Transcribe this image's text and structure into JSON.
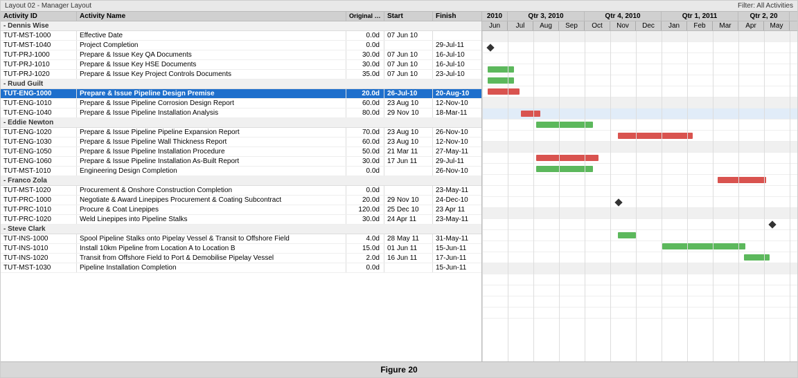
{
  "topBar": {
    "layout": "Layout 02 - Manager Layout",
    "filter": "Filter: All Activities"
  },
  "tableHeaders": {
    "activityId": "Activity ID",
    "activityName": "Activity Name",
    "originalDuration": "Original Duration",
    "start": "Start",
    "finish": "Finish"
  },
  "groups": [
    {
      "name": "Dennis Wise",
      "rows": [
        {
          "id": "TUT-MST-1000",
          "name": "Effective Date",
          "orig": "0.0d",
          "start": "07 Jun 10",
          "finish": "",
          "barType": "milestone",
          "barPos": 0
        },
        {
          "id": "TUT-MST-1040",
          "name": "Project Completion",
          "orig": "0.0d",
          "start": "",
          "finish": "29-Jul-11",
          "barType": "none",
          "barPos": 0
        },
        {
          "id": "TUT-PRJ-1000",
          "name": "Prepare & Issue Key QA Documents",
          "orig": "30.0d",
          "start": "07 Jun 10",
          "finish": "16-Jul-10",
          "barType": "green",
          "barPos": 1
        },
        {
          "id": "TUT-PRJ-1010",
          "name": "Prepare & Issue Key HSE Documents",
          "orig": "30.0d",
          "start": "07 Jun 10",
          "finish": "16-Jul-10",
          "barType": "green",
          "barPos": 1
        },
        {
          "id": "TUT-PRJ-1020",
          "name": "Prepare & Issue Key Project Controls Documents",
          "orig": "35.0d",
          "start": "07 Jun 10",
          "finish": "23-Jul-10",
          "barType": "red",
          "barPos": 1
        }
      ]
    },
    {
      "name": "Ruud Guilt",
      "rows": [
        {
          "id": "TUT-ENG-1000",
          "name": "Prepare & Issue Pipeline Design Premise",
          "orig": "20.0d",
          "start": "26-Jul-10",
          "finish": "20-Aug-10",
          "barType": "red",
          "barPos": 2,
          "highlighted": true
        },
        {
          "id": "TUT-ENG-1010",
          "name": "Prepare & Issue Pipeline Corrosion Design Report",
          "orig": "60.0d",
          "start": "23 Aug 10",
          "finish": "12-Nov-10",
          "barType": "green",
          "barPos": 3
        },
        {
          "id": "TUT-ENG-1040",
          "name": "Prepare & Issue Pipeline Installation Analysis",
          "orig": "80.0d",
          "start": "29 Nov 10",
          "finish": "18-Mar-11",
          "barType": "red",
          "barPos": 4
        }
      ]
    },
    {
      "name": "Eddie Newton",
      "rows": [
        {
          "id": "TUT-ENG-1020",
          "name": "Prepare & Issue Pipeline Pipeline Expansion Report",
          "orig": "70.0d",
          "start": "23 Aug 10",
          "finish": "26-Nov-10",
          "barType": "red",
          "barPos": 3
        },
        {
          "id": "TUT-ENG-1030",
          "name": "Prepare & Issue Pipeline Wall Thickness Report",
          "orig": "60.0d",
          "start": "23 Aug 10",
          "finish": "12-Nov-10",
          "barType": "green",
          "barPos": 3
        },
        {
          "id": "TUT-ENG-1050",
          "name": "Prepare & Issue Pipeline Installation Procedure",
          "orig": "50.0d",
          "start": "21 Mar 11",
          "finish": "27-May-11",
          "barType": "none",
          "barPos": 5
        },
        {
          "id": "TUT-ENG-1060",
          "name": "Prepare & Issue Pipeline Installation As-Built Report",
          "orig": "30.0d",
          "start": "17 Jun 11",
          "finish": "29-Jul-11",
          "barType": "none",
          "barPos": 6
        },
        {
          "id": "TUT-MST-1010",
          "name": "Engineering Design Completion",
          "orig": "0.0d",
          "start": "",
          "finish": "26-Nov-10",
          "barType": "milestone",
          "barPos": 3
        }
      ]
    },
    {
      "name": "Franco Zola",
      "rows": [
        {
          "id": "TUT-MST-1020",
          "name": "Procurement & Onshore Construction Completion",
          "orig": "0.0d",
          "start": "",
          "finish": "23-May-11",
          "barType": "milestone",
          "barPos": 5
        },
        {
          "id": "TUT-PRC-1000",
          "name": "Negotiate & Award Linepipes Procurement & Coating Subcontract",
          "orig": "20.0d",
          "start": "29 Nov 10",
          "finish": "24-Dec-10",
          "barType": "green",
          "barPos": 4
        },
        {
          "id": "TUT-PRC-1010",
          "name": "Procure & Coat Linepipes",
          "orig": "120.0d",
          "start": "25 Dec 10",
          "finish": "23 Apr 11",
          "barType": "green",
          "barPos": 5
        },
        {
          "id": "TUT-PRC-1020",
          "name": "Weld Linepipes into Pipeline Stalks",
          "orig": "30.0d",
          "start": "24 Apr 11",
          "finish": "23-May-11",
          "barType": "green",
          "barPos": 5
        }
      ]
    },
    {
      "name": "Steve Clark",
      "rows": [
        {
          "id": "TUT-INS-1000",
          "name": "Spool Pipeline Stalks onto Pipelay Vessel & Transit to Offshore Field",
          "orig": "4.0d",
          "start": "28 May 11",
          "finish": "31-May-11",
          "barType": "none",
          "barPos": 6
        },
        {
          "id": "TUT-INS-1010",
          "name": "Install 10km Pipeline from Location A to Location B",
          "orig": "15.0d",
          "start": "01 Jun 11",
          "finish": "15-Jun-11",
          "barType": "none",
          "barPos": 6
        },
        {
          "id": "TUT-INS-1020",
          "name": "Transit from Offshore Field to Port & Demobilise Pipelay Vessel",
          "orig": "2.0d",
          "start": "16 Jun 11",
          "finish": "17-Jun-11",
          "barType": "none",
          "barPos": 6
        },
        {
          "id": "TUT-MST-1030",
          "name": "Pipeline Installation Completion",
          "orig": "0.0d",
          "start": "",
          "finish": "15-Jun-11",
          "barType": "milestone",
          "barPos": 6
        }
      ]
    }
  ],
  "ganttYears": [
    {
      "label": "2010",
      "span": 4
    },
    {
      "label": "Qtr 3, 2010",
      "span": 3
    },
    {
      "label": "Qtr 4, 2010",
      "span": 3
    },
    {
      "label": "Qtr 1, 2011",
      "span": 3
    },
    {
      "label": "Qtr 2, 20",
      "span": 2
    }
  ],
  "ganttMonths": [
    "Jun",
    "Jul",
    "Aug",
    "Sep",
    "Oct",
    "Nov",
    "Dec",
    "Jan",
    "Feb",
    "Mar",
    "Apr",
    "May"
  ],
  "figureCaption": "Figure 20",
  "colors": {
    "highlight": "#1e6fcc",
    "barGreen": "#5cb85c",
    "barRed": "#d9534f",
    "headerBg": "#d0d0d0",
    "groupBg": "#f0f0f0"
  }
}
